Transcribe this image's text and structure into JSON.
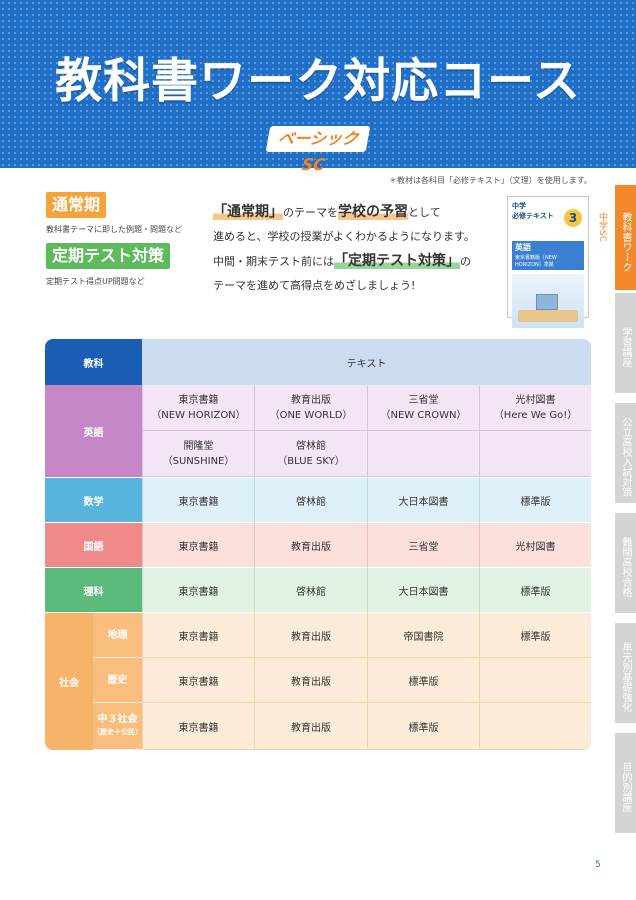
{
  "header": {
    "title": "教科書ワーク対応コース",
    "logo": "ベーシックSC"
  },
  "note": "＊教材は各科目「必修テキスト」（文理）を使用します。",
  "badges": [
    {
      "label": "通常期",
      "sub": "教科書テーマに即した例題・問題など"
    },
    {
      "label": "定期テスト対策",
      "sub": "定期テスト得点UP問題など"
    }
  ],
  "intro": {
    "l1_a": "「通常期」",
    "l1_b": "のテーマを",
    "l1_c": "学校の予習",
    "l1_d": "として",
    "l2": "進めると、学校の授業がよくわかるようになります。",
    "l3_a": "中間・期末テスト前には",
    "l3_b": "「定期テスト対策」",
    "l3_c": "の",
    "l4": "テーマを進めて高得点をめざしましょう!"
  },
  "book": {
    "kind": "中学",
    "name": "必修テキスト",
    "number": "3",
    "subject": "英語",
    "edition": "東京書籍版［NEW HORIZON］準拠"
  },
  "sidebar": {
    "active_sub": "中学SC",
    "tabs": [
      "教科書ワーク",
      "学習講座",
      "公立高校入試対策",
      "難関高校合格",
      "単元別基礎強化",
      "目的別講座"
    ]
  },
  "table": {
    "head": {
      "subject": "教科",
      "text": "テキスト"
    },
    "english": {
      "label": "英語",
      "row1": [
        "東京書籍\n（NEW HORIZON）",
        "教育出版\n（ONE WORLD）",
        "三省堂\n（NEW CROWN）",
        "光村図書\n（Here We Go!）"
      ],
      "row2": [
        "開隆堂\n（SUNSHINE）",
        "啓林館\n（BLUE SKY）",
        "",
        ""
      ]
    },
    "math": {
      "label": "数学",
      "cells": [
        "東京書籍",
        "啓林館",
        "大日本図書",
        "標準版"
      ]
    },
    "japanese": {
      "label": "国語",
      "cells": [
        "東京書籍",
        "教育出版",
        "三省堂",
        "光村図書"
      ]
    },
    "science": {
      "label": "理科",
      "cells": [
        "東京書籍",
        "啓林館",
        "大日本図書",
        "標準版"
      ]
    },
    "social": {
      "label": "社会",
      "rows": [
        {
          "sub": "地理",
          "sub_small": "",
          "cells": [
            "東京書籍",
            "教育出版",
            "帝国書院",
            "標準版"
          ]
        },
        {
          "sub": "歴史",
          "sub_small": "",
          "cells": [
            "東京書籍",
            "教育出版",
            "標準版",
            ""
          ]
        },
        {
          "sub": "中３社会",
          "sub_small": "（歴史＋公民）",
          "cells": [
            "東京書籍",
            "教育出版",
            "標準版",
            ""
          ]
        }
      ]
    }
  },
  "page_number": "5"
}
